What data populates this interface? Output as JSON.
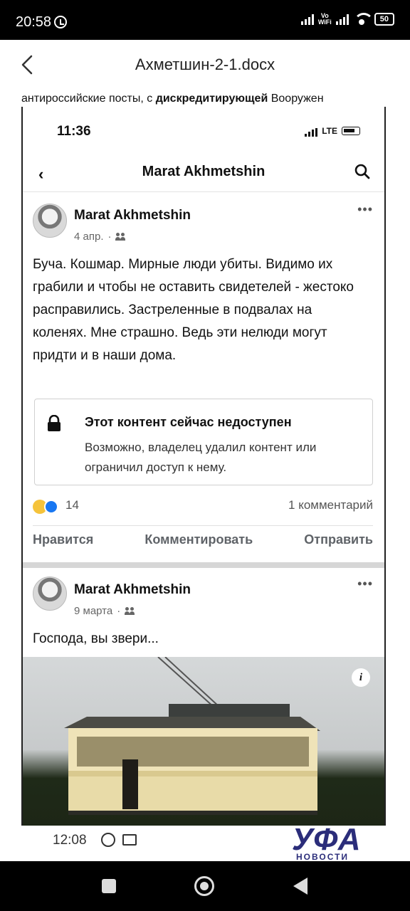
{
  "status_bar": {
    "time": "20:58",
    "vowifi_line1": "Vo",
    "vowifi_line2": "WiFi",
    "battery": "50"
  },
  "doc_header": {
    "title": "Ахметшин-2-1.docx"
  },
  "doc_text": {
    "before": "антироссийские посты, с ",
    "bold": "дискредитирующей",
    "after": " Вооружен"
  },
  "screenshot": {
    "time": "11:36",
    "network": "LTE",
    "nav_title": "Marat Akhmetshin",
    "post1": {
      "author": "Marat Akhmetshin",
      "date": "4 апр.",
      "text": "Буча. Кошмар. Мирные люди  убиты. Видимо их грабили и чтобы не оставить свидетелей - жестоко расправились. Застреленные в подвалах на коленях. Мне страшно. Ведь эти нелюди могут придти и в наши дома.",
      "notice_title": "Этот контент сейчас недоступен",
      "notice_text": "Возможно, владелец удалил контент или ограничил доступ к нему.",
      "reaction_count": "14",
      "comment_count": "1 комментарий"
    },
    "actions": {
      "like": "Нравится",
      "comment": "Комментировать",
      "share": "Отправить"
    },
    "post2": {
      "author": "Marat Akhmetshin",
      "date": "9 марта",
      "text": "Господа, вы звери..."
    }
  },
  "footer": {
    "time": "12:08"
  },
  "watermark": {
    "main": "УФА",
    "sub": "НОВОСТИ"
  }
}
